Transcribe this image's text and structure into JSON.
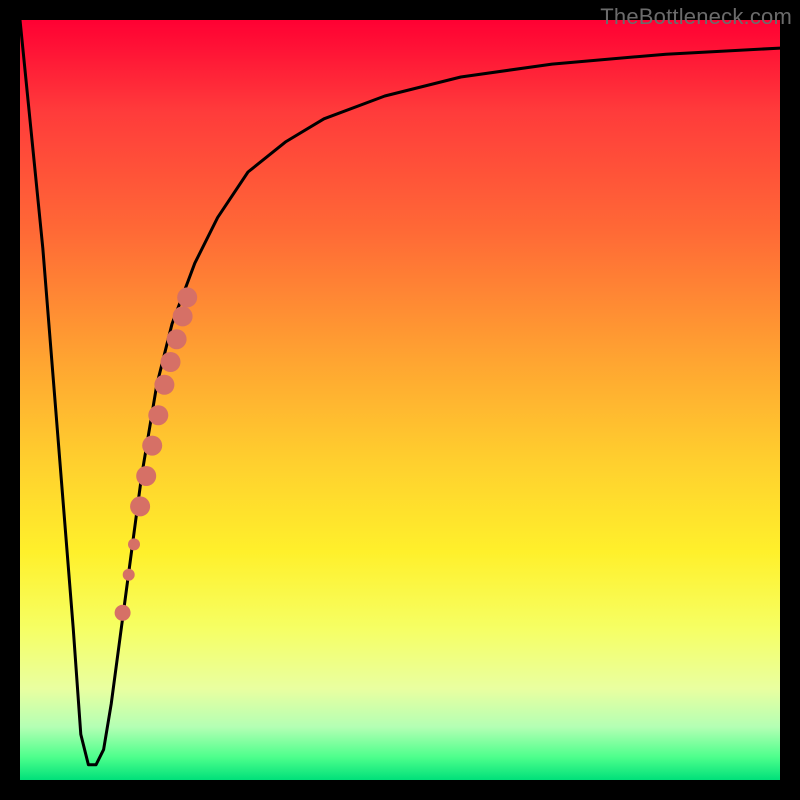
{
  "watermark": "TheBottleneck.com",
  "chart_data": {
    "type": "line",
    "title": "",
    "xlabel": "",
    "ylabel": "",
    "xlim": [
      0,
      100
    ],
    "ylim": [
      0,
      100
    ],
    "series": [
      {
        "name": "bottleneck-curve",
        "x": [
          0,
          3,
          5,
          7,
          8,
          9,
          10,
          11,
          12,
          14,
          16,
          18,
          20,
          23,
          26,
          30,
          35,
          40,
          48,
          58,
          70,
          85,
          100
        ],
        "values": [
          100,
          70,
          45,
          20,
          6,
          2,
          2,
          4,
          10,
          25,
          40,
          52,
          60,
          68,
          74,
          80,
          84,
          87,
          90,
          92.5,
          94.2,
          95.5,
          96.3
        ]
      }
    ],
    "highlight_segment": {
      "name": "dot-band",
      "points": [
        {
          "x": 13.5,
          "y": 22,
          "r": 8
        },
        {
          "x": 14.3,
          "y": 27,
          "r": 6
        },
        {
          "x": 15.0,
          "y": 31,
          "r": 6
        },
        {
          "x": 15.8,
          "y": 36,
          "r": 10
        },
        {
          "x": 16.6,
          "y": 40,
          "r": 10
        },
        {
          "x": 17.4,
          "y": 44,
          "r": 10
        },
        {
          "x": 18.2,
          "y": 48,
          "r": 10
        },
        {
          "x": 19.0,
          "y": 52,
          "r": 10
        },
        {
          "x": 19.8,
          "y": 55,
          "r": 10
        },
        {
          "x": 20.6,
          "y": 58,
          "r": 10
        },
        {
          "x": 21.4,
          "y": 61,
          "r": 10
        },
        {
          "x": 22.0,
          "y": 63.5,
          "r": 10
        }
      ],
      "color": "#d67066"
    },
    "curve_color": "#000000",
    "background_gradient": {
      "top": "#ff0033",
      "mid": "#ffd22e",
      "bottom": "#00e07a"
    }
  }
}
